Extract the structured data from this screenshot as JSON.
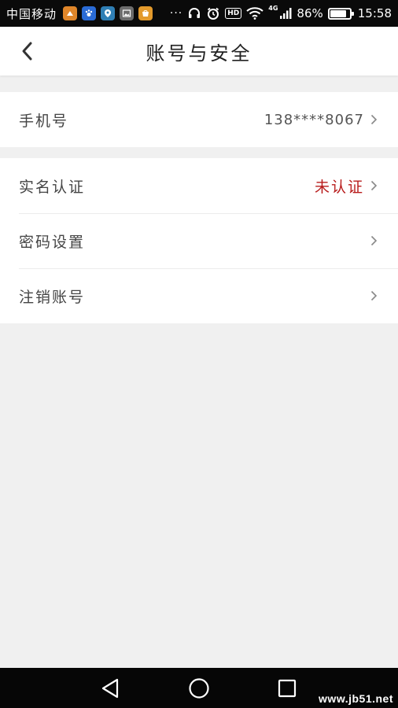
{
  "status_bar": {
    "carrier": "中国移动",
    "dots": "···",
    "hd": "HD",
    "network": "4G",
    "battery_percent": "86%",
    "battery_level": 0.86,
    "time": "15:58",
    "app_icons": [
      {
        "name": "app-icon-1",
        "color": "#e0862a"
      },
      {
        "name": "app-icon-2",
        "color": "#2a6bd6"
      },
      {
        "name": "app-icon-3",
        "color": "#2f7fb5"
      },
      {
        "name": "app-icon-4",
        "color": "#6c6c6c"
      },
      {
        "name": "app-icon-5",
        "color": "#e39a2c"
      }
    ]
  },
  "header": {
    "title": "账号与安全",
    "back_icon": "chevron-left-icon"
  },
  "groups": [
    {
      "rows": [
        {
          "label": "手机号",
          "value": "138****8067",
          "value_color": "#555555"
        }
      ]
    },
    {
      "rows": [
        {
          "label": "实名认证",
          "value": "未认证",
          "value_color": "#b81c1c"
        },
        {
          "label": "密码设置",
          "value": ""
        },
        {
          "label": "注销账号",
          "value": ""
        }
      ]
    }
  ],
  "nav_bar": {
    "icons": [
      "triangle-back-icon",
      "circle-home-icon",
      "square-recent-icon"
    ]
  },
  "watermark": "www.jb51.net",
  "colors": {
    "background": "#f0f0f0",
    "card": "#ffffff",
    "warning": "#b81c1c",
    "status_bar": "#0a0a0a"
  }
}
